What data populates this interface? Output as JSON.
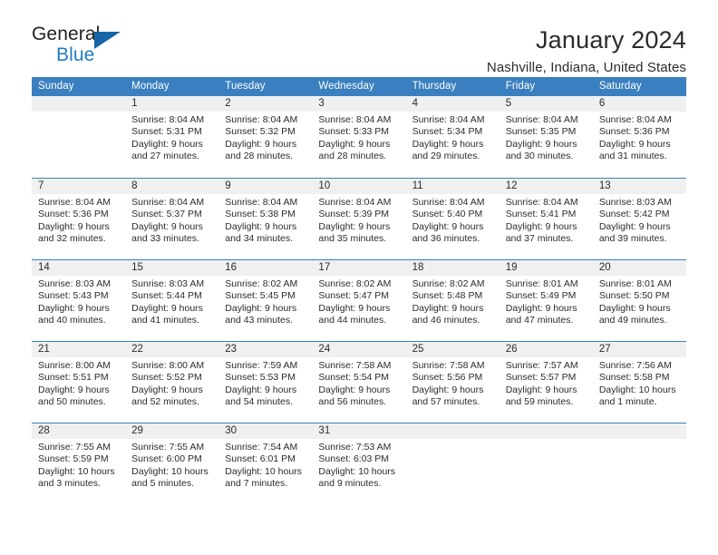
{
  "brand": {
    "name_part1": "General",
    "name_part2": "Blue",
    "accent_color": "#1f7bc4"
  },
  "header": {
    "title": "January 2024",
    "subtitle": "Nashville, Indiana, United States"
  },
  "calendar": {
    "header_bg": "#3a7fbf",
    "weekdays": [
      "Sunday",
      "Monday",
      "Tuesday",
      "Wednesday",
      "Thursday",
      "Friday",
      "Saturday"
    ],
    "weeks": [
      [
        {
          "day": "",
          "sunrise": "",
          "sunset": "",
          "daylight": "",
          "empty": true
        },
        {
          "day": "1",
          "sunrise": "Sunrise: 8:04 AM",
          "sunset": "Sunset: 5:31 PM",
          "daylight": "Daylight: 9 hours and 27 minutes."
        },
        {
          "day": "2",
          "sunrise": "Sunrise: 8:04 AM",
          "sunset": "Sunset: 5:32 PM",
          "daylight": "Daylight: 9 hours and 28 minutes."
        },
        {
          "day": "3",
          "sunrise": "Sunrise: 8:04 AM",
          "sunset": "Sunset: 5:33 PM",
          "daylight": "Daylight: 9 hours and 28 minutes."
        },
        {
          "day": "4",
          "sunrise": "Sunrise: 8:04 AM",
          "sunset": "Sunset: 5:34 PM",
          "daylight": "Daylight: 9 hours and 29 minutes."
        },
        {
          "day": "5",
          "sunrise": "Sunrise: 8:04 AM",
          "sunset": "Sunset: 5:35 PM",
          "daylight": "Daylight: 9 hours and 30 minutes."
        },
        {
          "day": "6",
          "sunrise": "Sunrise: 8:04 AM",
          "sunset": "Sunset: 5:36 PM",
          "daylight": "Daylight: 9 hours and 31 minutes."
        }
      ],
      [
        {
          "day": "7",
          "sunrise": "Sunrise: 8:04 AM",
          "sunset": "Sunset: 5:36 PM",
          "daylight": "Daylight: 9 hours and 32 minutes."
        },
        {
          "day": "8",
          "sunrise": "Sunrise: 8:04 AM",
          "sunset": "Sunset: 5:37 PM",
          "daylight": "Daylight: 9 hours and 33 minutes."
        },
        {
          "day": "9",
          "sunrise": "Sunrise: 8:04 AM",
          "sunset": "Sunset: 5:38 PM",
          "daylight": "Daylight: 9 hours and 34 minutes."
        },
        {
          "day": "10",
          "sunrise": "Sunrise: 8:04 AM",
          "sunset": "Sunset: 5:39 PM",
          "daylight": "Daylight: 9 hours and 35 minutes."
        },
        {
          "day": "11",
          "sunrise": "Sunrise: 8:04 AM",
          "sunset": "Sunset: 5:40 PM",
          "daylight": "Daylight: 9 hours and 36 minutes."
        },
        {
          "day": "12",
          "sunrise": "Sunrise: 8:04 AM",
          "sunset": "Sunset: 5:41 PM",
          "daylight": "Daylight: 9 hours and 37 minutes."
        },
        {
          "day": "13",
          "sunrise": "Sunrise: 8:03 AM",
          "sunset": "Sunset: 5:42 PM",
          "daylight": "Daylight: 9 hours and 39 minutes."
        }
      ],
      [
        {
          "day": "14",
          "sunrise": "Sunrise: 8:03 AM",
          "sunset": "Sunset: 5:43 PM",
          "daylight": "Daylight: 9 hours and 40 minutes."
        },
        {
          "day": "15",
          "sunrise": "Sunrise: 8:03 AM",
          "sunset": "Sunset: 5:44 PM",
          "daylight": "Daylight: 9 hours and 41 minutes."
        },
        {
          "day": "16",
          "sunrise": "Sunrise: 8:02 AM",
          "sunset": "Sunset: 5:45 PM",
          "daylight": "Daylight: 9 hours and 43 minutes."
        },
        {
          "day": "17",
          "sunrise": "Sunrise: 8:02 AM",
          "sunset": "Sunset: 5:47 PM",
          "daylight": "Daylight: 9 hours and 44 minutes."
        },
        {
          "day": "18",
          "sunrise": "Sunrise: 8:02 AM",
          "sunset": "Sunset: 5:48 PM",
          "daylight": "Daylight: 9 hours and 46 minutes."
        },
        {
          "day": "19",
          "sunrise": "Sunrise: 8:01 AM",
          "sunset": "Sunset: 5:49 PM",
          "daylight": "Daylight: 9 hours and 47 minutes."
        },
        {
          "day": "20",
          "sunrise": "Sunrise: 8:01 AM",
          "sunset": "Sunset: 5:50 PM",
          "daylight": "Daylight: 9 hours and 49 minutes."
        }
      ],
      [
        {
          "day": "21",
          "sunrise": "Sunrise: 8:00 AM",
          "sunset": "Sunset: 5:51 PM",
          "daylight": "Daylight: 9 hours and 50 minutes."
        },
        {
          "day": "22",
          "sunrise": "Sunrise: 8:00 AM",
          "sunset": "Sunset: 5:52 PM",
          "daylight": "Daylight: 9 hours and 52 minutes."
        },
        {
          "day": "23",
          "sunrise": "Sunrise: 7:59 AM",
          "sunset": "Sunset: 5:53 PM",
          "daylight": "Daylight: 9 hours and 54 minutes."
        },
        {
          "day": "24",
          "sunrise": "Sunrise: 7:58 AM",
          "sunset": "Sunset: 5:54 PM",
          "daylight": "Daylight: 9 hours and 56 minutes."
        },
        {
          "day": "25",
          "sunrise": "Sunrise: 7:58 AM",
          "sunset": "Sunset: 5:56 PM",
          "daylight": "Daylight: 9 hours and 57 minutes."
        },
        {
          "day": "26",
          "sunrise": "Sunrise: 7:57 AM",
          "sunset": "Sunset: 5:57 PM",
          "daylight": "Daylight: 9 hours and 59 minutes."
        },
        {
          "day": "27",
          "sunrise": "Sunrise: 7:56 AM",
          "sunset": "Sunset: 5:58 PM",
          "daylight": "Daylight: 10 hours and 1 minute."
        }
      ],
      [
        {
          "day": "28",
          "sunrise": "Sunrise: 7:55 AM",
          "sunset": "Sunset: 5:59 PM",
          "daylight": "Daylight: 10 hours and 3 minutes."
        },
        {
          "day": "29",
          "sunrise": "Sunrise: 7:55 AM",
          "sunset": "Sunset: 6:00 PM",
          "daylight": "Daylight: 10 hours and 5 minutes."
        },
        {
          "day": "30",
          "sunrise": "Sunrise: 7:54 AM",
          "sunset": "Sunset: 6:01 PM",
          "daylight": "Daylight: 10 hours and 7 minutes."
        },
        {
          "day": "31",
          "sunrise": "Sunrise: 7:53 AM",
          "sunset": "Sunset: 6:03 PM",
          "daylight": "Daylight: 10 hours and 9 minutes."
        },
        {
          "day": "",
          "sunrise": "",
          "sunset": "",
          "daylight": "",
          "empty": true
        },
        {
          "day": "",
          "sunrise": "",
          "sunset": "",
          "daylight": "",
          "empty": true
        },
        {
          "day": "",
          "sunrise": "",
          "sunset": "",
          "daylight": "",
          "empty": true
        }
      ]
    ]
  }
}
